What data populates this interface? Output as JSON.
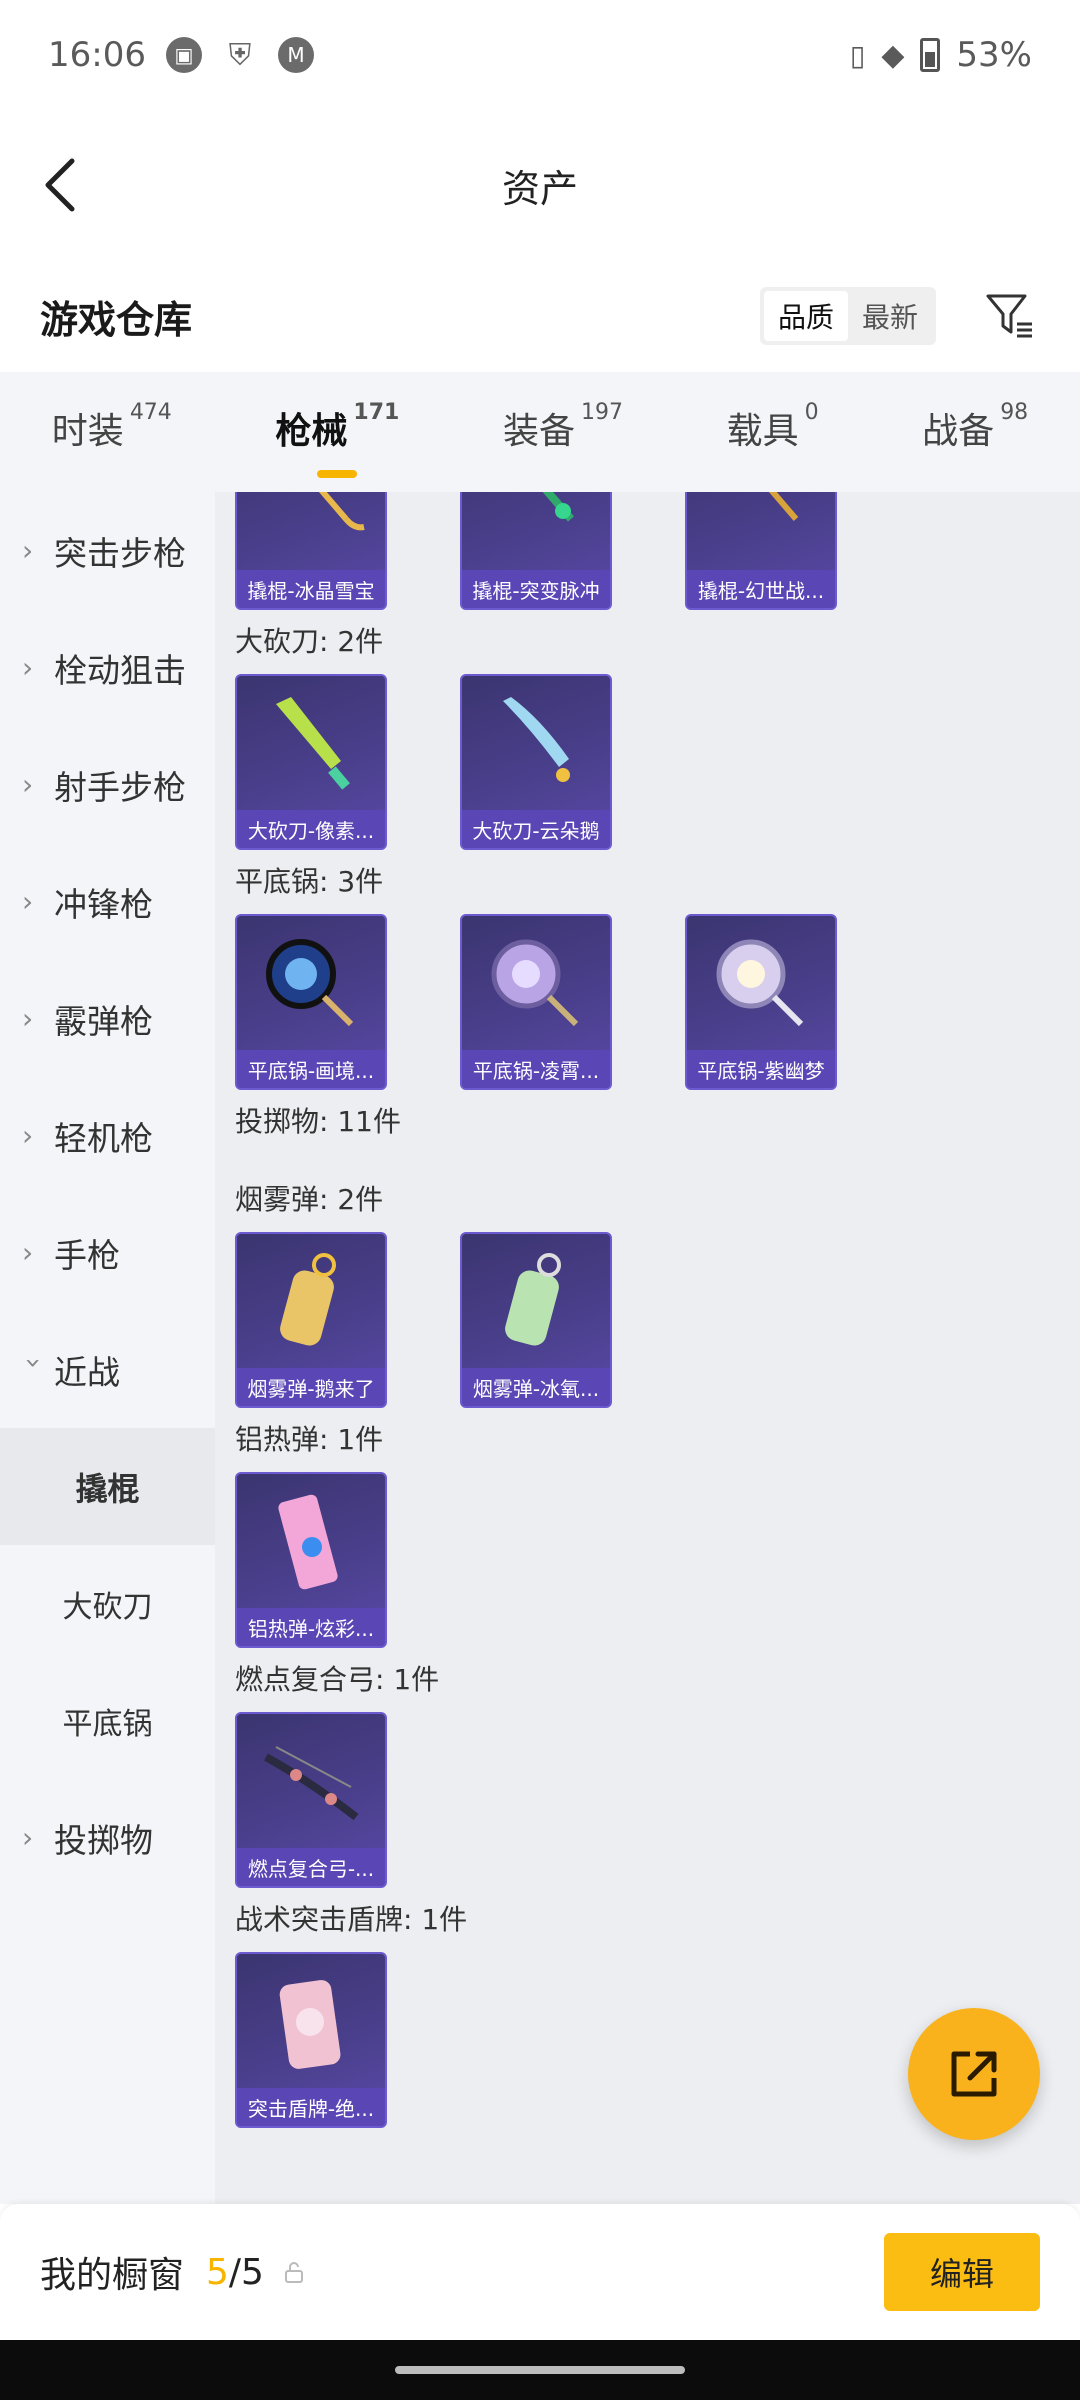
{
  "status_bar": {
    "time": "16:06",
    "battery": "53%",
    "icons": [
      "calendar-icon",
      "shield-icon",
      "motorola-icon",
      "vibrate-icon",
      "wifi-icon",
      "battery-icon"
    ]
  },
  "header": {
    "title": "资产",
    "back_icon": "chevron-left-icon"
  },
  "warehouse": {
    "title": "游戏仓库",
    "sort_options": [
      "品质",
      "最新"
    ],
    "sort_selected": "品质",
    "filter_icon": "filter-icon"
  },
  "tabs": [
    {
      "label": "时装",
      "count": "474"
    },
    {
      "label": "枪械",
      "count": "171",
      "active": true
    },
    {
      "label": "装备",
      "count": "197"
    },
    {
      "label": "载具",
      "count": "0"
    },
    {
      "label": "战备",
      "count": "98"
    }
  ],
  "sidebar": {
    "items": [
      {
        "label": "突击步枪"
      },
      {
        "label": "栓动狙击"
      },
      {
        "label": "射手步枪"
      },
      {
        "label": "冲锋枪"
      },
      {
        "label": "霰弹枪"
      },
      {
        "label": "轻机枪"
      },
      {
        "label": "手枪"
      },
      {
        "label": "近战",
        "expanded": true
      },
      {
        "label": "撬棍",
        "sub": true,
        "active": true
      },
      {
        "label": "大砍刀",
        "sub": true
      },
      {
        "label": "平底锅",
        "sub": true
      },
      {
        "label": "投掷物"
      }
    ]
  },
  "content": {
    "top_cards": [
      "撬棍-冰晶雪宝",
      "撬棍-突变脉冲",
      "撬棍-幻世战..."
    ],
    "groups": [
      {
        "label": "大砍刀: 2件",
        "cards": [
          "大砍刀-像素...",
          "大砍刀-云朵鹅"
        ]
      },
      {
        "label": "平底锅: 3件",
        "cards": [
          "平底锅-画境...",
          "平底锅-凌霄...",
          "平底锅-紫幽梦"
        ]
      },
      {
        "label": "投掷物: 11件",
        "cards": []
      },
      {
        "label": "烟雾弹: 2件",
        "cards": [
          "烟雾弹-鹅来了",
          "烟雾弹-冰氧..."
        ]
      },
      {
        "label": "铝热弹: 1件",
        "cards": [
          "铝热弹-炫彩..."
        ]
      },
      {
        "label": "燃点复合弓: 1件",
        "cards": [
          "燃点复合弓-..."
        ]
      },
      {
        "label": "战术突击盾牌: 1件",
        "cards": [
          "突击盾牌-绝..."
        ]
      }
    ]
  },
  "fab": {
    "icon": "share-external-icon"
  },
  "bottom_bar": {
    "label": "我的橱窗",
    "count_current": "5",
    "count_total": "/5",
    "lock_icon": "lock-icon",
    "edit_label": "编辑"
  }
}
